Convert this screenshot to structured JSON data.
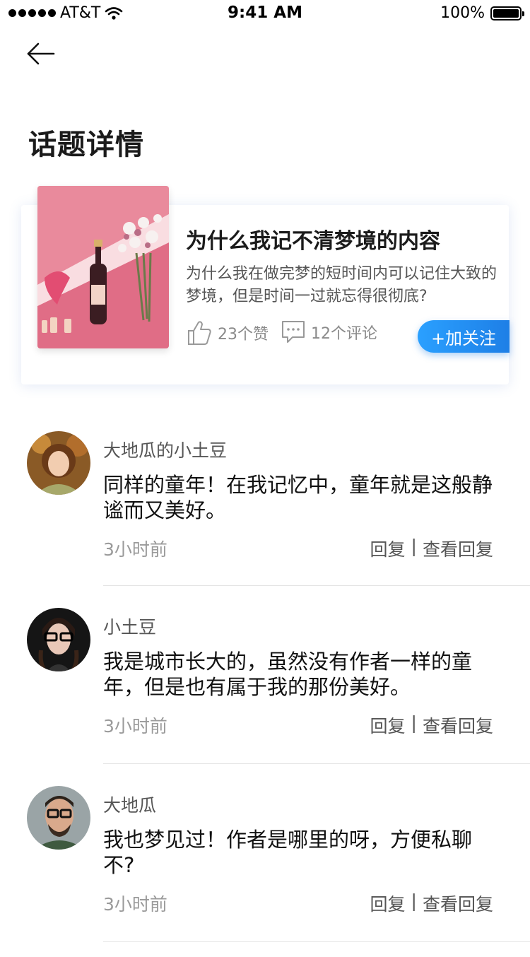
{
  "status_bar": {
    "carrier": "AT&T",
    "time": "9:41 AM",
    "battery": "100%"
  },
  "page": {
    "title": "话题详情"
  },
  "topic": {
    "title": "为什么我记不清梦境的内容",
    "description": "为什么我在做完梦的短时间内可以记住大致的梦境，但是时间一过就忘得很彻底?",
    "likes": "23个赞",
    "comments": "12个评论",
    "follow_label": "+加关注"
  },
  "comments": [
    {
      "name": "大地瓜的小土豆",
      "text": "同样的童年！在我记忆中，童年就是这般静谧而又美好。",
      "time": "3小时前",
      "reply": "回复",
      "view_replies": "查看回复"
    },
    {
      "name": "小土豆",
      "text": "我是城市长大的，虽然没有作者一样的童年，但是也有属于我的那份美好。",
      "time": "3小时前",
      "reply": "回复",
      "view_replies": "查看回复"
    },
    {
      "name": "大地瓜",
      "text": "我也梦见过！作者是哪里的呀，方便私聊不?",
      "time": "3小时前",
      "reply": "回复",
      "view_replies": "查看回复"
    }
  ],
  "action_separator": "|",
  "colors": {
    "accent": "#1e8ef0",
    "card_shadow": "#5078c8"
  }
}
